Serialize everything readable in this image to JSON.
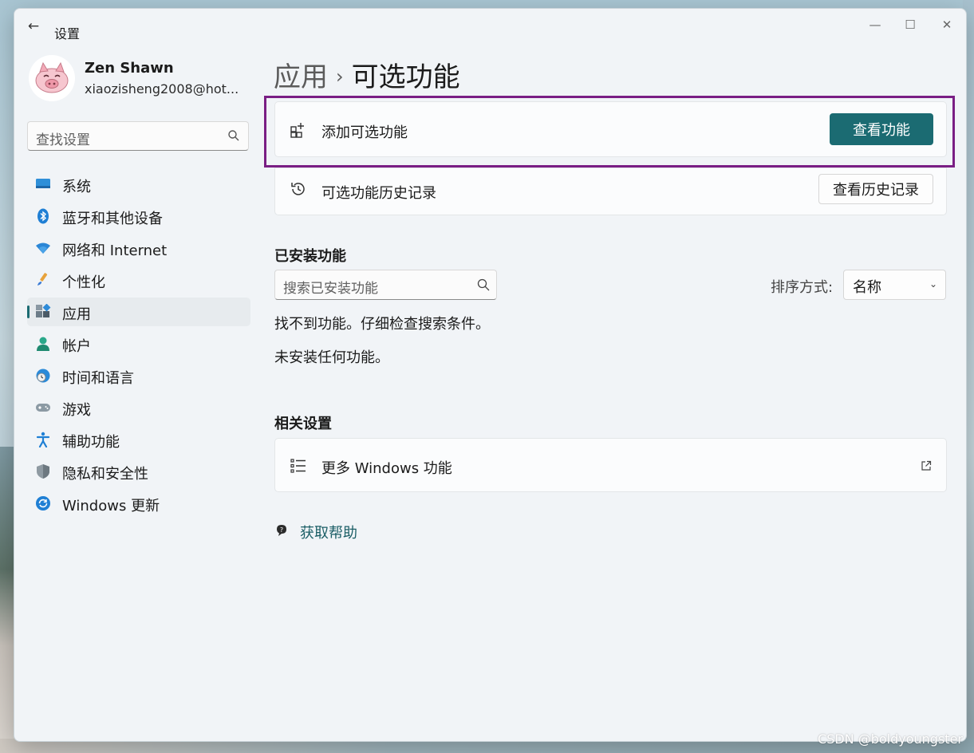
{
  "window": {
    "title": "设置",
    "controls": {
      "minimize": "—",
      "maximize": "☐",
      "close": "✕"
    }
  },
  "user": {
    "name": "Zen Shawn",
    "email": "xiaozisheng2008@hot..."
  },
  "sidebar": {
    "search_placeholder": "查找设置",
    "items": [
      {
        "label": "系统",
        "icon": "system-icon",
        "active": false
      },
      {
        "label": "蓝牙和其他设备",
        "icon": "bluetooth-icon",
        "active": false
      },
      {
        "label": "网络和 Internet",
        "icon": "wifi-icon",
        "active": false
      },
      {
        "label": "个性化",
        "icon": "brush-icon",
        "active": false
      },
      {
        "label": "应用",
        "icon": "apps-icon",
        "active": true
      },
      {
        "label": "帐户",
        "icon": "account-icon",
        "active": false
      },
      {
        "label": "时间和语言",
        "icon": "time-language-icon",
        "active": false
      },
      {
        "label": "游戏",
        "icon": "gamepad-icon",
        "active": false
      },
      {
        "label": "辅助功能",
        "icon": "accessibility-icon",
        "active": false
      },
      {
        "label": "隐私和安全性",
        "icon": "shield-icon",
        "active": false
      },
      {
        "label": "Windows 更新",
        "icon": "update-icon",
        "active": false
      }
    ]
  },
  "breadcrumb": {
    "parent": "应用",
    "separator": "›",
    "current": "可选功能"
  },
  "add_feature": {
    "label": "添加可选功能",
    "button": "查看功能"
  },
  "history": {
    "label": "可选功能历史记录",
    "button": "查看历史记录"
  },
  "installed": {
    "heading": "已安装功能",
    "search_placeholder": "搜索已安装功能",
    "sort_label": "排序方式:",
    "sort_value": "名称",
    "not_found": "找不到功能。仔细检查搜索条件。",
    "none_installed": "未安装任何功能。"
  },
  "related": {
    "heading": "相关设置",
    "more_windows_features": "更多 Windows 功能"
  },
  "help": {
    "label": "获取帮助"
  },
  "watermark": "CSDN @boldyoungster",
  "colors": {
    "accent": "#1b6b72",
    "highlight_border": "#7a1e84"
  }
}
